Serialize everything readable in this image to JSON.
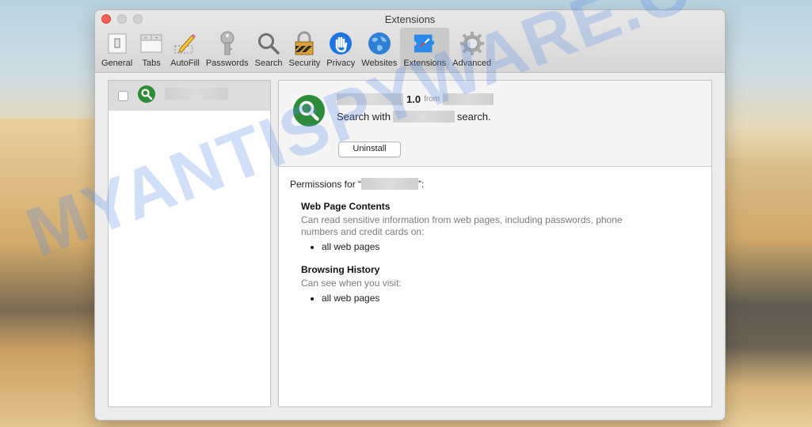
{
  "window": {
    "title": "Extensions"
  },
  "toolbar": {
    "items": [
      {
        "label": "General",
        "icon": "general-switch-icon"
      },
      {
        "label": "Tabs",
        "icon": "tabs-icon"
      },
      {
        "label": "AutoFill",
        "icon": "pencil-icon"
      },
      {
        "label": "Passwords",
        "icon": "key-icon"
      },
      {
        "label": "Search",
        "icon": "magnifier-icon"
      },
      {
        "label": "Security",
        "icon": "padlock-icon"
      },
      {
        "label": "Privacy",
        "icon": "hand-icon"
      },
      {
        "label": "Websites",
        "icon": "globe-icon"
      },
      {
        "label": "Extensions",
        "icon": "puzzle-compass-icon",
        "active": true
      },
      {
        "label": "Advanced",
        "icon": "gear-icon"
      }
    ]
  },
  "extension_list": {
    "items": [
      {
        "name": "[redacted]",
        "enabled": false,
        "icon": "green-search-icon",
        "selected": true
      }
    ]
  },
  "detail": {
    "name": "[redacted]",
    "version": "1.0",
    "from_label": "from",
    "developer": "[redacted]",
    "description_prefix": "Search with",
    "description_redacted": "[redacted]",
    "description_suffix": "search.",
    "uninstall_label": "Uninstall",
    "permissions_prefix": "Permissions for “",
    "permissions_suffix": "”:",
    "permissions": [
      {
        "title": "Web Page Contents",
        "description": "Can read sensitive information from web pages, including passwords, phone numbers and credit cards on:",
        "targets": [
          "all web pages"
        ]
      },
      {
        "title": "Browsing History",
        "description": "Can see when you visit:",
        "targets": [
          "all web pages"
        ]
      }
    ]
  },
  "watermark": "MYANTISPYWARE.COM",
  "colors": {
    "close": "#fe5f57",
    "accent_green": "#2e8b3a",
    "privacy_blue": "#1f74e0"
  }
}
